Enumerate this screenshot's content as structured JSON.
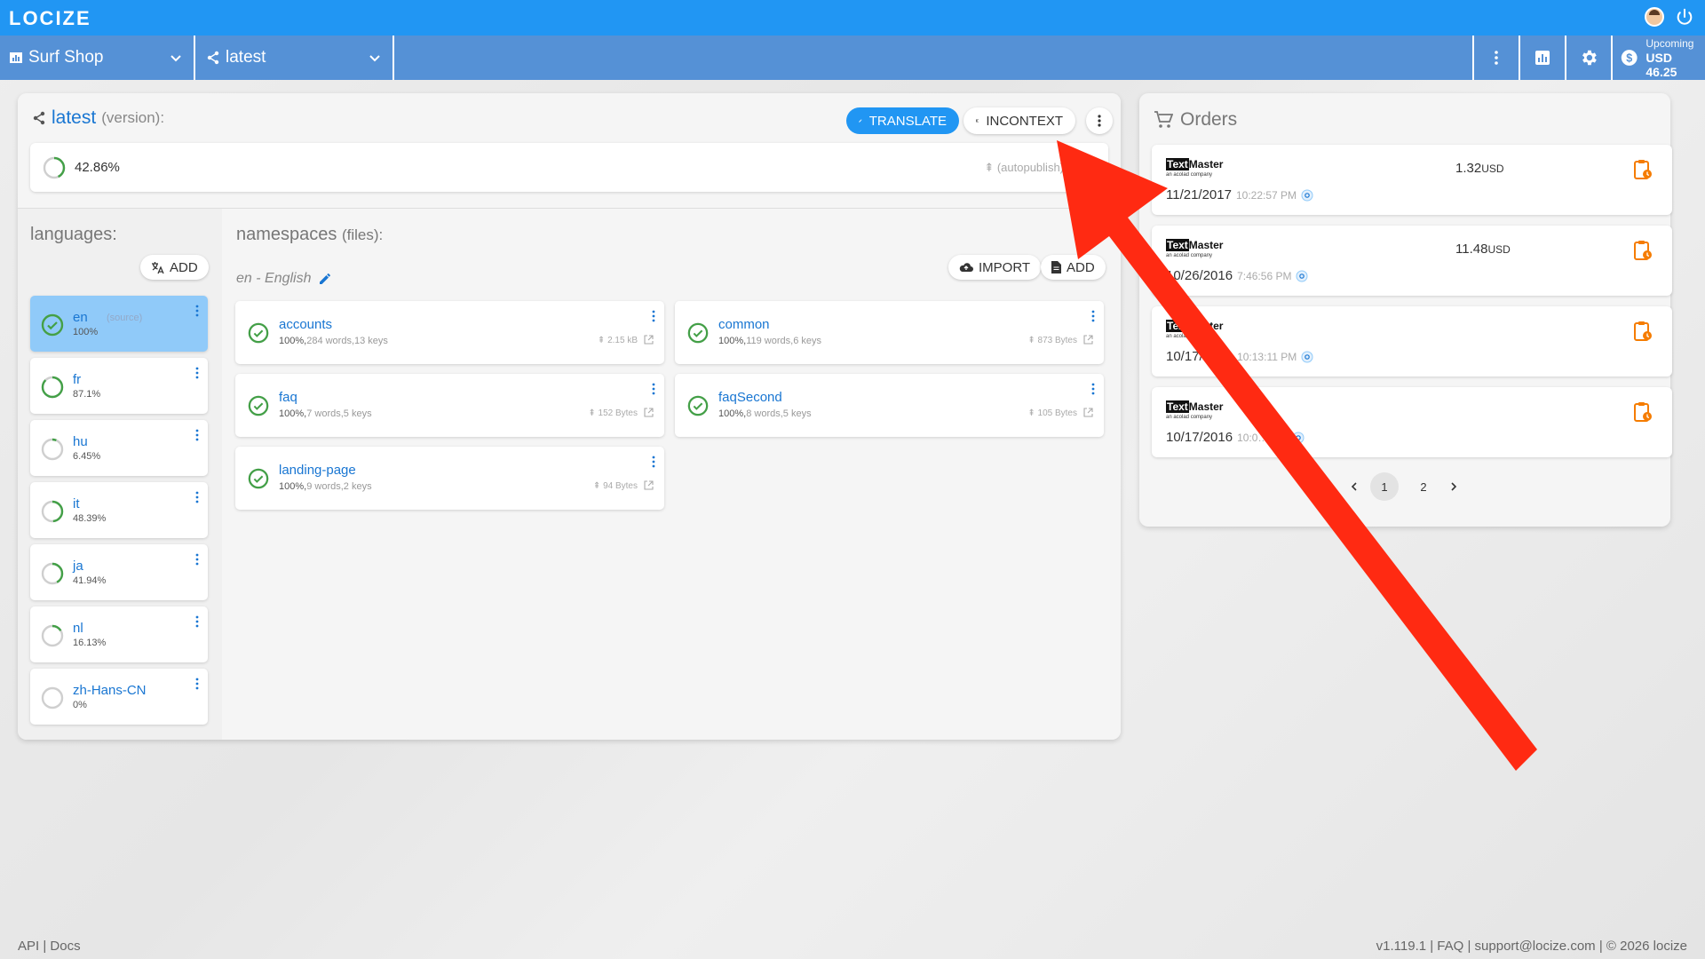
{
  "app": {
    "logo": "LOCIZE"
  },
  "topbar": {
    "project_label": "Surf Shop",
    "version_label": "latest",
    "upcoming_label": "Upcoming",
    "upcoming_amount": "USD 46.25"
  },
  "version_card": {
    "version_name": "latest",
    "version_suffix": "(version):",
    "translate_label": "TRANSLATE",
    "incontext_label": "INCONTEXT",
    "progress_pct": "42.86%",
    "progress_value": 0.4286,
    "autopublish_text": "(autopublish)"
  },
  "languages": {
    "title": "languages:",
    "add_label": "ADD",
    "items": [
      {
        "code": "en",
        "note": "(source)",
        "pct": "100%",
        "value": 1.0
      },
      {
        "code": "fr",
        "pct": "87.1%",
        "value": 0.871
      },
      {
        "code": "hu",
        "pct": "6.45%",
        "value": 0.0645
      },
      {
        "code": "it",
        "pct": "48.39%",
        "value": 0.4839
      },
      {
        "code": "ja",
        "pct": "41.94%",
        "value": 0.4194
      },
      {
        "code": "nl",
        "pct": "16.13%",
        "value": 0.1613
      },
      {
        "code": "zh-Hans-CN",
        "pct": "0%",
        "value": 0
      }
    ]
  },
  "namespaces": {
    "title": "namespaces",
    "title_suffix": "(files):",
    "current_language": "en - English",
    "import_label": "IMPORT",
    "add_label": "ADD",
    "items": [
      {
        "name": "accounts",
        "pct": "100%,",
        "detail": "284 words,13 keys",
        "size": "2.15 kB"
      },
      {
        "name": "common",
        "pct": "100%,",
        "detail": "119 words,6 keys",
        "size": "873 Bytes"
      },
      {
        "name": "faq",
        "pct": "100%,",
        "detail": "7 words,5 keys",
        "size": "152 Bytes"
      },
      {
        "name": "faqSecond",
        "pct": "100%,",
        "detail": "8 words,5 keys",
        "size": "105 Bytes"
      },
      {
        "name": "landing-page",
        "pct": "100%,",
        "detail": "9 words,2 keys",
        "size": "94 Bytes"
      }
    ]
  },
  "orders": {
    "title": "Orders",
    "vendor_logo": "TextMaster",
    "vendor_tag": "an acolad company",
    "items": [
      {
        "price": "1.32",
        "currency": "USD",
        "date": "11/21/2017",
        "time": "10:22:57 PM"
      },
      {
        "price": "11.48",
        "currency": "USD",
        "date": "10/26/2016",
        "time": "7:46:56 PM"
      },
      {
        "price": "",
        "currency": "",
        "date": "10/17/2016",
        "time": "10:13:11 PM"
      },
      {
        "price": "",
        "currency": "",
        "date": "10/17/2016",
        "time": "10:0… PM"
      }
    ],
    "pages": [
      "1",
      "2"
    ],
    "current_page": "1"
  },
  "footer": {
    "left": "API | Docs",
    "right": "v1.119.1 | FAQ | support@locize.com | © 2026 locize"
  },
  "colors": {
    "primary": "#2196f3",
    "secondary_bar": "#5591d6",
    "success": "#43a047",
    "annotation_arrow": "#ff2a12",
    "order_icon": "#f57c00"
  }
}
